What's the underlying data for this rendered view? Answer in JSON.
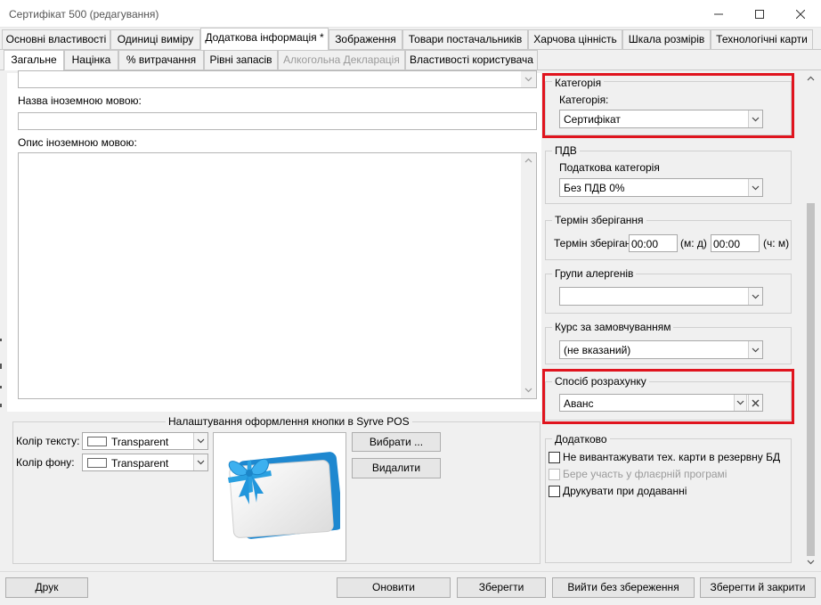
{
  "window": {
    "title": "Сертифікат 500 (редагування)"
  },
  "tabs": [
    {
      "label": "Основні властивості"
    },
    {
      "label": "Одиниці виміру"
    },
    {
      "label": "Додаткова інформація *"
    },
    {
      "label": "Зображення"
    },
    {
      "label": "Товари постачальників"
    },
    {
      "label": "Харчова цінність"
    },
    {
      "label": "Шкала розмірів"
    },
    {
      "label": "Технологічні карти"
    }
  ],
  "subtabs": [
    {
      "label": "Загальне"
    },
    {
      "label": "Націнка"
    },
    {
      "label": "% витрачання"
    },
    {
      "label": "Рівні запасів"
    },
    {
      "label": "Алкогольна Декларація"
    },
    {
      "label": "Властивості користувача"
    }
  ],
  "left": {
    "foreign_name_label": "Назва іноземною мовою:",
    "foreign_name_value": "",
    "foreign_desc_label": "Опис іноземною мовою:",
    "foreign_desc_value": ""
  },
  "pos_settings": {
    "title": "Налаштування оформлення кнопки в Syrve POS",
    "text_color_label": "Колір тексту:",
    "text_color_value": "Transparent",
    "bg_color_label": "Колір фону:",
    "bg_color_value": "Transparent",
    "choose_button": "Вибрати ...",
    "delete_button": "Видалити"
  },
  "category": {
    "title": "Категорія",
    "label": "Категорія:",
    "value": "Сертифікат"
  },
  "vat": {
    "title": "ПДВ",
    "label": "Податкова категорія",
    "value": "Без ПДВ 0%"
  },
  "shelf_life": {
    "title": "Термін зберігання",
    "label": "Термін зберіганн",
    "days_value": "00:00",
    "days_unit": "(м: д)",
    "hours_value": "00:00",
    "hours_unit": "(ч: м)"
  },
  "allergens": {
    "title": "Групи алергенів",
    "value": ""
  },
  "default_rate": {
    "title": "Курс за замовчуванням",
    "value": "(не вказаний)"
  },
  "calc_method": {
    "title": "Спосіб розрахунку",
    "value": "Аванс"
  },
  "additional": {
    "title": "Додатково",
    "check1": "Не вивантажувати тех. карти в резервну БД",
    "check2": "Бере участь у флаєрній програмі",
    "check3": "Друкувати при додаванні"
  },
  "buttons": {
    "print": "Друк",
    "refresh": "Оновити",
    "save": "Зберегти",
    "exit_no_save": "Вийти без збереження",
    "save_close": "Зберегти й закрити"
  },
  "colors": {
    "highlight_red": "#e0141e",
    "gift_ribbon": "#2aa0e0",
    "gift_card": "#1e88d0"
  },
  "icons": [
    "minimize-icon",
    "maximize-icon",
    "close-icon",
    "chevron-down-icon",
    "clear-x-icon",
    "gift-card-icon"
  ]
}
